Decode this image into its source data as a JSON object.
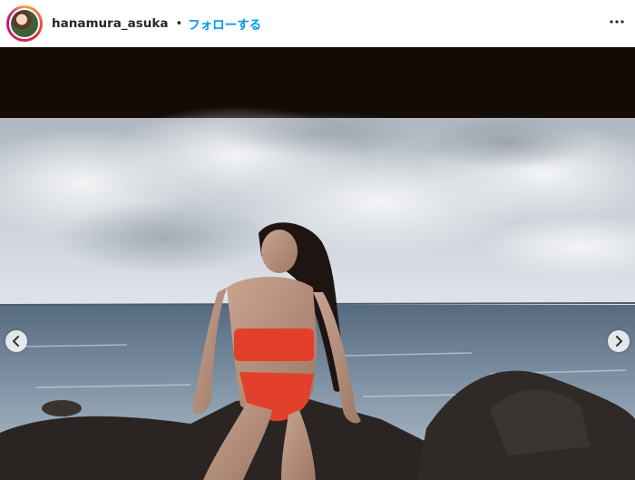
{
  "post": {
    "username": "hanamura_asuka",
    "separator": "•",
    "follow_label": "フォローする"
  },
  "icons": {
    "avatar": "profile-avatar",
    "more": "more-options-icon",
    "prev": "chevron-left-icon",
    "next": "chevron-right-icon"
  },
  "colors": {
    "link": "#0095f6",
    "text": "#262626",
    "avatar_ring": [
      "#f9a23a",
      "#dc2743",
      "#bc1888"
    ],
    "photo_top_band": "#140b06",
    "swimsuit": "#e2402a"
  }
}
